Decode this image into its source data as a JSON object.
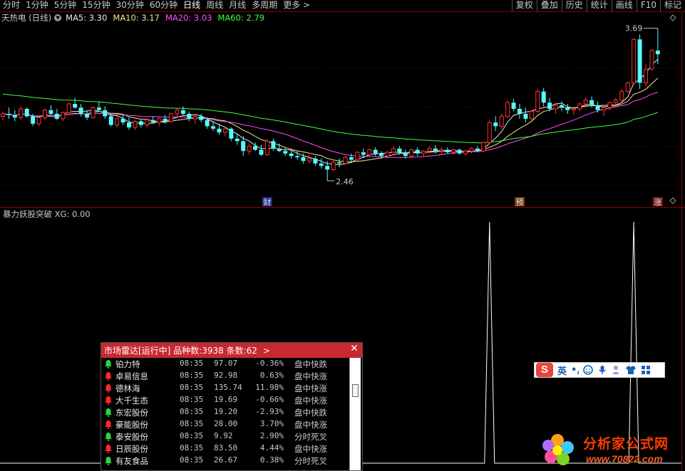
{
  "toolbar": {
    "periods": [
      "分时",
      "1分钟",
      "5分钟",
      "15分钟",
      "30分钟",
      "60分钟",
      "日线",
      "周线",
      "月线",
      "多周期",
      "更多 >"
    ],
    "active_period": "日线",
    "right_buttons": [
      "复权",
      "叠加",
      "历史",
      "统计",
      "画线",
      "F10",
      "标记"
    ]
  },
  "stock_title": "天热电 (日线)",
  "ma_legend": [
    {
      "label": "MA5: 3.30",
      "color": "#e8e8e8"
    },
    {
      "label": "MA10: 3.17",
      "color": "#f0e68c"
    },
    {
      "label": "MA20: 3.03",
      "color": "#ff4cff"
    },
    {
      "label": "MA60: 2.79",
      "color": "#3cff3c"
    }
  ],
  "chart_data": {
    "type": "candlestick",
    "price_annotations": {
      "high": "3.69",
      "low": "2.46"
    },
    "event_markers": [
      "财",
      "预",
      "涨"
    ],
    "candles": [
      [
        2.98,
        3.02,
        2.95,
        3.0
      ],
      [
        3.0,
        3.05,
        2.96,
        2.99
      ],
      [
        2.99,
        3.03,
        2.94,
        2.97
      ],
      [
        2.97,
        3.06,
        2.95,
        3.04
      ],
      [
        3.04,
        3.05,
        2.97,
        2.98
      ],
      [
        2.98,
        3.0,
        2.9,
        2.92
      ],
      [
        2.92,
        2.99,
        2.9,
        2.97
      ],
      [
        2.97,
        3.04,
        2.95,
        3.03
      ],
      [
        3.03,
        3.07,
        2.99,
        3.0
      ],
      [
        3.0,
        3.04,
        2.95,
        2.96
      ],
      [
        2.96,
        3.02,
        2.94,
        3.01
      ],
      [
        3.01,
        3.09,
        3.0,
        3.08
      ],
      [
        3.08,
        3.13,
        3.04,
        3.05
      ],
      [
        3.05,
        3.08,
        2.98,
        3.0
      ],
      [
        3.0,
        3.03,
        2.95,
        2.97
      ],
      [
        2.97,
        3.06,
        2.96,
        3.05
      ],
      [
        3.05,
        3.1,
        3.02,
        3.03
      ],
      [
        3.03,
        3.06,
        2.96,
        2.98
      ],
      [
        2.98,
        3.0,
        2.9,
        2.91
      ],
      [
        2.91,
        2.98,
        2.89,
        2.96
      ],
      [
        2.96,
        3.0,
        2.91,
        2.93
      ],
      [
        2.93,
        2.97,
        2.87,
        2.89
      ],
      [
        2.89,
        2.95,
        2.87,
        2.94
      ],
      [
        2.94,
        2.96,
        2.89,
        2.91
      ],
      [
        2.91,
        2.96,
        2.89,
        2.95
      ],
      [
        2.95,
        2.98,
        2.92,
        2.93
      ],
      [
        2.93,
        2.97,
        2.9,
        2.96
      ],
      [
        2.96,
        2.99,
        2.92,
        2.94
      ],
      [
        2.94,
        3.01,
        2.93,
        3.0
      ],
      [
        3.0,
        3.05,
        2.98,
        3.03
      ],
      [
        3.03,
        3.06,
        2.99,
        3.0
      ],
      [
        3.0,
        3.02,
        2.94,
        2.96
      ],
      [
        2.96,
        2.99,
        2.92,
        2.98
      ],
      [
        2.98,
        3.0,
        2.93,
        2.95
      ],
      [
        2.95,
        2.97,
        2.88,
        2.9
      ],
      [
        2.9,
        2.94,
        2.86,
        2.88
      ],
      [
        2.88,
        2.92,
        2.83,
        2.85
      ],
      [
        2.85,
        2.9,
        2.82,
        2.88
      ],
      [
        2.88,
        2.89,
        2.78,
        2.8
      ],
      [
        2.8,
        2.84,
        2.75,
        2.78
      ],
      [
        2.78,
        2.82,
        2.66,
        2.7
      ],
      [
        2.7,
        2.76,
        2.67,
        2.74
      ],
      [
        2.74,
        2.77,
        2.7,
        2.71
      ],
      [
        2.71,
        2.75,
        2.66,
        2.67
      ],
      [
        2.67,
        2.8,
        2.66,
        2.78
      ],
      [
        2.78,
        2.8,
        2.7,
        2.72
      ],
      [
        2.72,
        2.76,
        2.69,
        2.7
      ],
      [
        2.7,
        2.73,
        2.66,
        2.68
      ],
      [
        2.68,
        2.71,
        2.64,
        2.66
      ],
      [
        2.66,
        2.7,
        2.63,
        2.65
      ],
      [
        2.65,
        2.68,
        2.6,
        2.62
      ],
      [
        2.62,
        2.67,
        2.6,
        2.64
      ],
      [
        2.64,
        2.66,
        2.58,
        2.6
      ],
      [
        2.6,
        2.64,
        2.56,
        2.58
      ],
      [
        2.58,
        2.62,
        2.46,
        2.55
      ],
      [
        2.55,
        2.63,
        2.54,
        2.61
      ],
      [
        2.61,
        2.64,
        2.57,
        2.6
      ],
      [
        2.6,
        2.66,
        2.59,
        2.65
      ],
      [
        2.65,
        2.68,
        2.61,
        2.63
      ],
      [
        2.63,
        2.7,
        2.62,
        2.69
      ],
      [
        2.69,
        2.72,
        2.65,
        2.67
      ],
      [
        2.67,
        2.72,
        2.66,
        2.71
      ],
      [
        2.71,
        2.73,
        2.66,
        2.68
      ],
      [
        2.68,
        2.7,
        2.64,
        2.66
      ],
      [
        2.66,
        2.7,
        2.64,
        2.69
      ],
      [
        2.69,
        2.74,
        2.67,
        2.72
      ],
      [
        2.72,
        2.74,
        2.67,
        2.69
      ],
      [
        2.69,
        2.71,
        2.64,
        2.66
      ],
      [
        2.66,
        2.72,
        2.65,
        2.71
      ],
      [
        2.71,
        2.73,
        2.66,
        2.68
      ],
      [
        2.68,
        2.71,
        2.65,
        2.7
      ],
      [
        2.7,
        2.74,
        2.68,
        2.72
      ],
      [
        2.72,
        2.75,
        2.68,
        2.7
      ],
      [
        2.7,
        2.73,
        2.67,
        2.71
      ],
      [
        2.71,
        2.73,
        2.68,
        2.69
      ],
      [
        2.69,
        2.72,
        2.67,
        2.71
      ],
      [
        2.71,
        2.72,
        2.67,
        2.68
      ],
      [
        2.68,
        2.71,
        2.66,
        2.7
      ],
      [
        2.7,
        2.73,
        2.68,
        2.72
      ],
      [
        2.72,
        2.74,
        2.69,
        2.7
      ],
      [
        2.7,
        2.78,
        2.69,
        2.77
      ],
      [
        2.77,
        2.95,
        2.76,
        2.93
      ],
      [
        2.93,
        2.98,
        2.86,
        2.9
      ],
      [
        2.9,
        3.0,
        2.88,
        2.98
      ],
      [
        2.98,
        3.11,
        2.96,
        3.09
      ],
      [
        3.09,
        3.12,
        3.02,
        3.04
      ],
      [
        3.04,
        3.08,
        2.96,
        3.0
      ],
      [
        3.0,
        3.05,
        2.93,
        2.96
      ],
      [
        2.96,
        3.03,
        2.95,
        3.02
      ],
      [
        3.02,
        3.2,
        3.01,
        3.18
      ],
      [
        3.18,
        3.21,
        3.06,
        3.09
      ],
      [
        3.09,
        3.13,
        3.02,
        3.04
      ],
      [
        3.04,
        3.09,
        3.0,
        3.07
      ],
      [
        3.07,
        3.1,
        3.02,
        3.05
      ],
      [
        3.05,
        3.08,
        3.0,
        3.03
      ],
      [
        3.03,
        3.06,
        2.99,
        3.04
      ],
      [
        3.04,
        3.09,
        3.02,
        3.08
      ],
      [
        3.08,
        3.13,
        3.05,
        3.11
      ],
      [
        3.11,
        3.14,
        3.05,
        3.07
      ],
      [
        3.07,
        3.1,
        3.01,
        3.03
      ],
      [
        3.03,
        3.06,
        2.98,
        3.05
      ],
      [
        3.05,
        3.1,
        3.03,
        3.09
      ],
      [
        3.09,
        3.13,
        3.06,
        3.11
      ],
      [
        3.11,
        3.2,
        3.1,
        3.18
      ],
      [
        3.18,
        3.26,
        3.17,
        3.25
      ],
      [
        3.25,
        3.61,
        3.24,
        3.6
      ],
      [
        3.6,
        3.64,
        3.2,
        3.25
      ],
      [
        3.25,
        3.4,
        3.22,
        3.36
      ],
      [
        3.36,
        3.52,
        3.35,
        3.51
      ],
      [
        3.51,
        3.69,
        3.4,
        3.48
      ]
    ],
    "indicator": {
      "title": "暴力妖股突破 XG: 0.00",
      "signal_bars": [
        81,
        105
      ]
    }
  },
  "radar": {
    "title": "市场雷达[运行中] 品种数:3938 条数:62",
    "more": ">",
    "rows": [
      {
        "name": "铂力特",
        "time": "08:35",
        "price": "97.07",
        "pct": "-0.36%",
        "type": "盘中快跌",
        "bell": "green"
      },
      {
        "name": "卓易信息",
        "time": "08:35",
        "price": "92.98",
        "pct": "0.63%",
        "type": "盘中快涨",
        "bell": "red"
      },
      {
        "name": "德林海",
        "time": "08:35",
        "price": "135.74",
        "pct": "11.98%",
        "type": "盘中快涨",
        "bell": "red"
      },
      {
        "name": "大千生态",
        "time": "08:35",
        "price": "19.69",
        "pct": "-0.66%",
        "type": "盘中快涨",
        "bell": "red"
      },
      {
        "name": "东宏股份",
        "time": "08:35",
        "price": "19.20",
        "pct": "-2.93%",
        "type": "盘中快跌",
        "bell": "green"
      },
      {
        "name": "豪能股份",
        "time": "08:35",
        "price": "28.00",
        "pct": "3.70%",
        "type": "盘中快涨",
        "bell": "red"
      },
      {
        "name": "泰安股份",
        "time": "08:35",
        "price": "9.92",
        "pct": "2.90%",
        "type": "分时死叉",
        "bell": "green"
      },
      {
        "name": "日辰股份",
        "time": "08:35",
        "price": "83.50",
        "pct": "4.44%",
        "type": "盘中快涨",
        "bell": "red"
      },
      {
        "name": "有友食品",
        "time": "08:35",
        "price": "26.67",
        "pct": "0.38%",
        "type": "分时死叉",
        "bell": "green"
      }
    ]
  },
  "ime": {
    "lang": "英"
  },
  "watermark": {
    "title": "分析家公式网",
    "url": "www.70822.com"
  }
}
